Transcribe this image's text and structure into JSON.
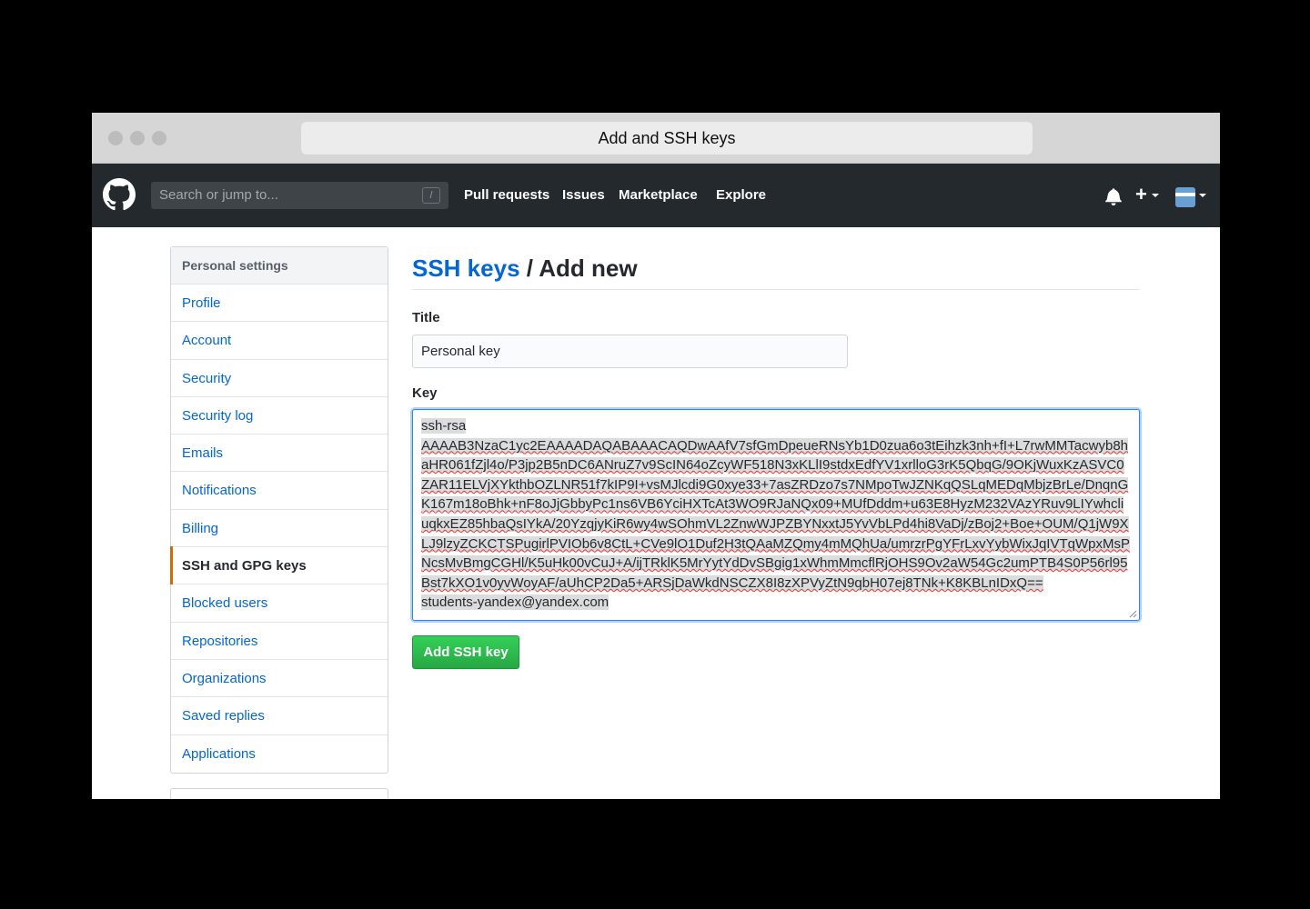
{
  "window": {
    "title": "Add and SSH keys"
  },
  "header": {
    "search_placeholder": "Search or jump to...",
    "search_shortcut": "/",
    "nav": [
      "Pull requests",
      "Issues",
      "Marketplace",
      "Explore"
    ],
    "plus_label": "+",
    "icons": [
      "github-logo-icon",
      "bell-icon",
      "plus-icon",
      "avatar"
    ]
  },
  "sidebar": {
    "heading": "Personal settings",
    "items": [
      {
        "label": "Profile"
      },
      {
        "label": "Account"
      },
      {
        "label": "Security"
      },
      {
        "label": "Security log"
      },
      {
        "label": "Emails"
      },
      {
        "label": "Notifications"
      },
      {
        "label": "Billing"
      },
      {
        "label": "SSH and GPG keys",
        "active": true
      },
      {
        "label": "Blocked users"
      },
      {
        "label": "Repositories"
      },
      {
        "label": "Organizations"
      },
      {
        "label": "Saved replies"
      },
      {
        "label": "Applications"
      }
    ]
  },
  "main": {
    "breadcrumb_link": "SSH keys",
    "breadcrumb_rest": " / Add new",
    "title_label": "Title",
    "title_value": "Personal key",
    "key_label": "Key",
    "key_prefix": "ssh-rsa",
    "key_body": "AAAAB3NzaC1yc2EAAAADAQABAAACAQDwAAfV7sfGmDpeueRNsYb1D0zua6o3tEihzk3nh+fI+L7rwMMTacwyb8haHR061fZjl4o/P3jp2B5nDC6ANruZ7v9ScIN64oZcyWF518N3xKLlI9stdxEdfYV1xrlloG3rK5QbqG/9OKjWuxKzASVC0ZAR11ELVjXYkthbOZLNR51f7kIP9I+vsMJlcdi9G0xye33+7asZRDzo7s7NMpoTwJZNKqQSLqMEDqMbjzBrLe/DnqnGK167m18oBhk+nF8oJjGbbyPc1ns6VB6YciHXTcAt3WO9RJaNQx09+MUfDddm+u63E8HyzM232VAzYRuv9LIYwhcliuqkxEZ85hbaQsIYkA/20YzqjyKiR6wy4wSOhmVL2ZnwWJPZBYNxxtJ5YvVbLPd4hi8VaDj/zBoj2+Boe+OUM/Q1jW9XLJ9lzyZCKCTSPugirlPVIOb6v8CtL+CVe9lO1Duf2H3tQAaMZQmy4mMQhUa/umrzrPgYFrLxvYybWixJqIVTqWpxMsPNcsMvBmgCGHl/K5uHk00vCuJ+A/ijTRklK5MrYytYdDvSBgig1xWhmMmcflRjOHS9Ov2aW54Gc2umPTB4S0P56rl95Bst7kXO1v0yvWoyAF/aUhCP2Da5+ARSjDaWkdNSCZX8I8zXPVyZtN9qbH07ej8TNk+K8KBLnIDxQ==",
    "key_suffix": "students-yandex@yandex.com",
    "submit_label": "Add SSH key"
  }
}
